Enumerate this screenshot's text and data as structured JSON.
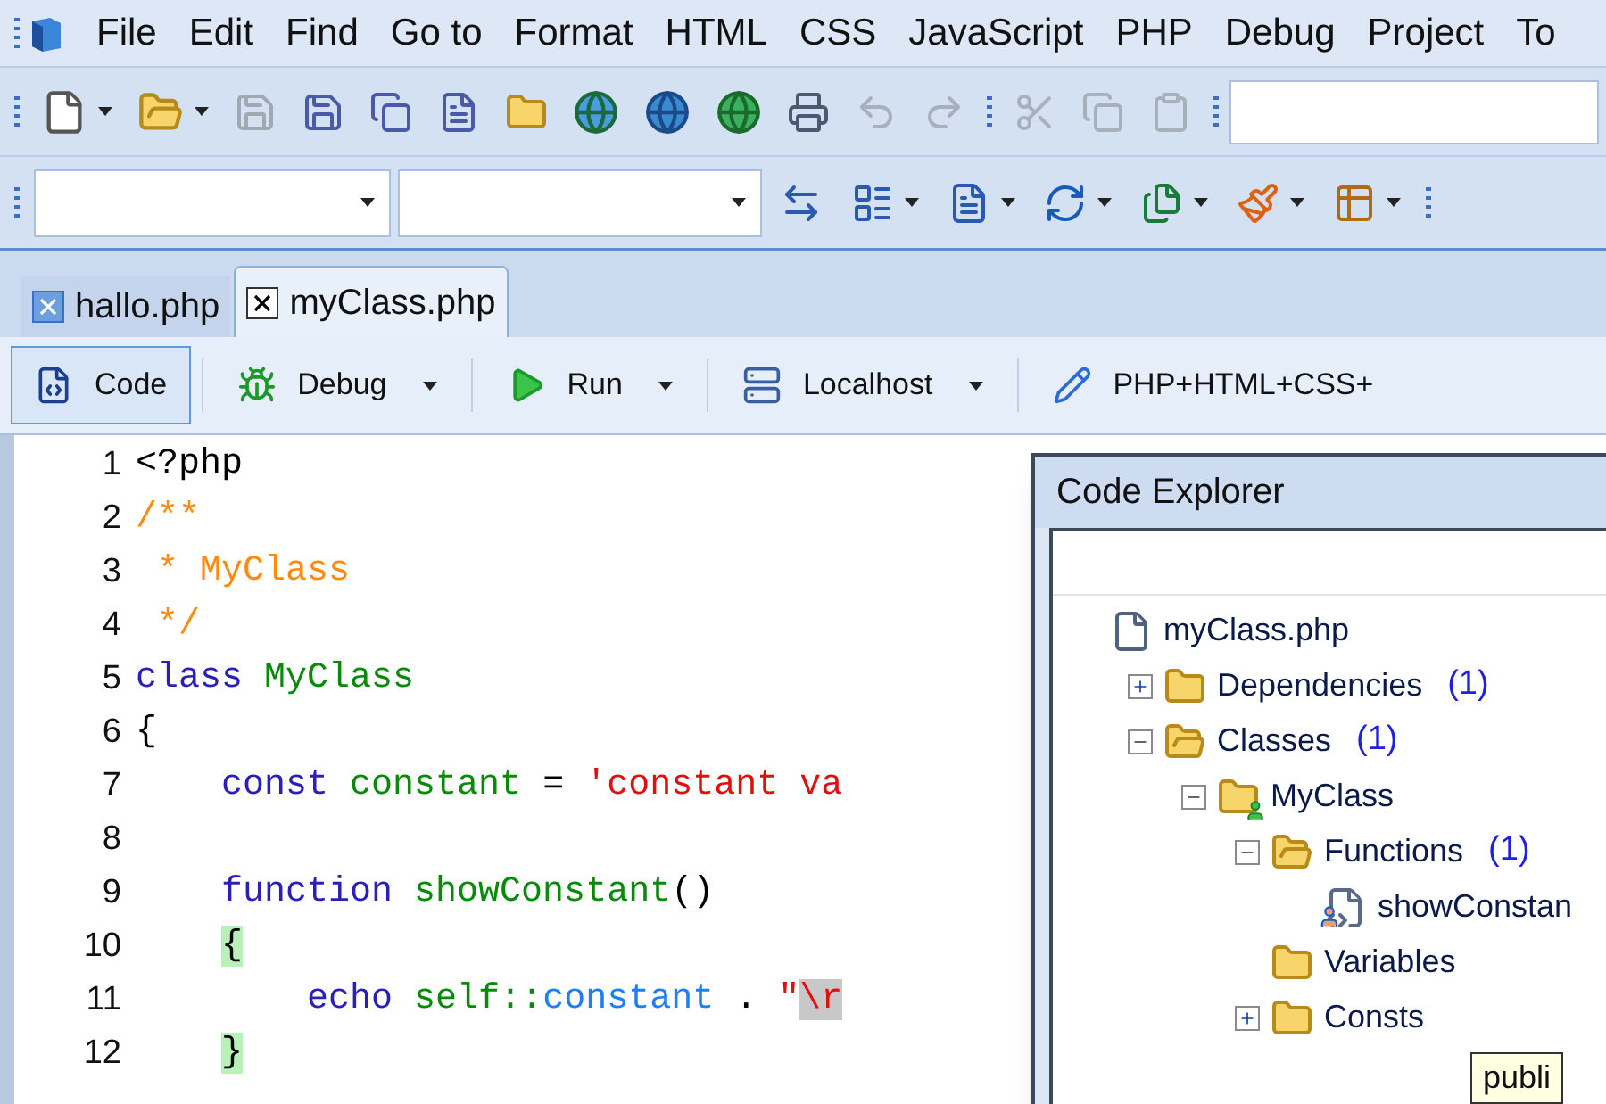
{
  "menu": [
    {
      "label": "File"
    },
    {
      "label": "Edit"
    },
    {
      "label": "Find"
    },
    {
      "label": "Go to"
    },
    {
      "label": "Format"
    },
    {
      "label": "HTML"
    },
    {
      "label": "CSS"
    },
    {
      "label": "JavaScript"
    },
    {
      "label": "PHP"
    },
    {
      "label": "Debug"
    },
    {
      "label": "Project"
    },
    {
      "label": "To"
    }
  ],
  "document_tabs": [
    {
      "label": "hallo.php",
      "selected": false
    },
    {
      "label": "myClass.php",
      "selected": true
    }
  ],
  "view_toolbar": [
    {
      "kind": "code",
      "label": "Code",
      "selected": true,
      "has_menu": false
    },
    {
      "kind": "debug",
      "label": "Debug",
      "selected": false,
      "has_menu": true
    },
    {
      "kind": "run",
      "label": "Run",
      "selected": false,
      "has_menu": true
    },
    {
      "kind": "server",
      "label": "Localhost",
      "selected": false,
      "has_menu": true
    },
    {
      "kind": "pencil",
      "label": "PHP+HTML+CSS+",
      "selected": false,
      "has_menu": false
    }
  ],
  "editor": {
    "lines": [
      {
        "number": "1",
        "tokens": [
          {
            "kind": "plain",
            "text": "<?php"
          }
        ]
      },
      {
        "number": "2",
        "tokens": [
          {
            "kind": "comment",
            "text": "/**"
          }
        ]
      },
      {
        "number": "3",
        "tokens": [
          {
            "kind": "comment",
            "text": " * MyClass"
          }
        ]
      },
      {
        "number": "4",
        "tokens": [
          {
            "kind": "comment",
            "text": " */"
          }
        ]
      },
      {
        "number": "5",
        "tokens": [
          {
            "kind": "keyword",
            "text": "class"
          },
          {
            "kind": "name",
            "text": " MyClass"
          }
        ]
      },
      {
        "number": "6",
        "tokens": [
          {
            "kind": "plain",
            "text": "{"
          }
        ]
      },
      {
        "number": "7",
        "tokens": [
          {
            "kind": "keyword",
            "text": "    const"
          },
          {
            "kind": "name",
            "text": " constant"
          },
          {
            "kind": "plain",
            "text": " = "
          },
          {
            "kind": "string",
            "text": "'constant va"
          }
        ]
      },
      {
        "number": "8"
      },
      {
        "number": "9",
        "tokens": [
          {
            "kind": "keyword",
            "text": "    function"
          },
          {
            "kind": "name",
            "text": " showConstant"
          },
          {
            "kind": "plain",
            "text": "()"
          }
        ]
      },
      {
        "number": "10",
        "tokens": [
          {
            "kind": "bracket",
            "text": "    {"
          }
        ]
      },
      {
        "number": "11",
        "tokens": [
          {
            "kind": "keyword",
            "text": "        echo"
          },
          {
            "kind": "name",
            "text": " self::"
          },
          {
            "kind": "constant",
            "text": "constant"
          },
          {
            "kind": "plain",
            "text": " . "
          },
          {
            "kind": "string",
            "text": "\""
          },
          {
            "kind": "escape",
            "text": "\\r"
          }
        ]
      },
      {
        "number": "12",
        "tokens": [
          {
            "kind": "bracket",
            "text": "    }"
          }
        ]
      }
    ]
  },
  "code_explorer": {
    "title": "Code Explorer",
    "tree": [
      {
        "kind": "file",
        "label": "myClass.php",
        "children": [
          {
            "kind": "folder",
            "label": "Dependencies",
            "count": "(1)",
            "expanded": false
          },
          {
            "kind": "folder",
            "label": "Classes",
            "count": "(1)",
            "expanded": true,
            "children": [
              {
                "kind": "class",
                "label": "MyClass",
                "expanded": true,
                "children": [
                  {
                    "kind": "folder",
                    "label": "Functions",
                    "count": "(1)",
                    "expanded": true,
                    "children": [
                      {
                        "kind": "function",
                        "label": "showConstan"
                      }
                    ]
                  },
                  {
                    "kind": "folder",
                    "label": "Variables"
                  },
                  {
                    "kind": "folder",
                    "label": "Consts",
                    "expanded": false
                  }
                ]
              }
            ]
          }
        ]
      }
    ],
    "tooltip": "publi"
  }
}
